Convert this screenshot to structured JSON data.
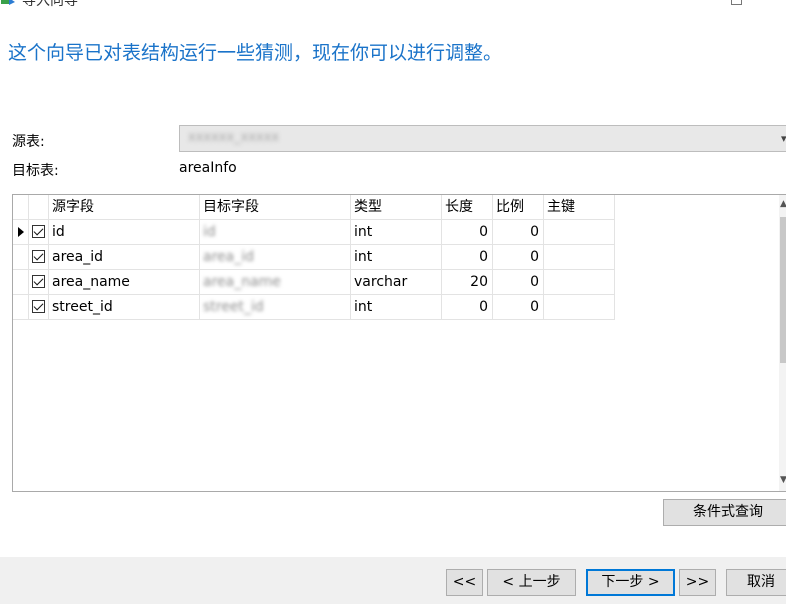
{
  "window": {
    "title": "导入向导"
  },
  "heading": "这个向导已对表结构运行一些猜测，现在你可以进行调整。",
  "source_table": {
    "label": "源表:",
    "value": "xxxxxx_xxxxx"
  },
  "target_table": {
    "label": "目标表:",
    "value": "areaInfo"
  },
  "grid": {
    "columns": [
      "源字段",
      "目标字段",
      "类型",
      "长度",
      "比例",
      "主键"
    ],
    "rows": [
      {
        "source": "id",
        "target": "id",
        "type": "int",
        "length": "0",
        "scale": "0",
        "pk": "",
        "checked": true,
        "current": true
      },
      {
        "source": "area_id",
        "target": "area_id",
        "type": "int",
        "length": "0",
        "scale": "0",
        "pk": "",
        "checked": true,
        "current": false
      },
      {
        "source": "area_name",
        "target": "area_name",
        "type": "varchar",
        "length": "20",
        "scale": "0",
        "pk": "",
        "checked": true,
        "current": false
      },
      {
        "source": "street_id",
        "target": "street_id",
        "type": "int",
        "length": "0",
        "scale": "0",
        "pk": "",
        "checked": true,
        "current": false
      }
    ]
  },
  "buttons": {
    "conditional_query": "条件式查询",
    "first": "<<",
    "prev": "< 上一步",
    "next": "下一步 >",
    "last": ">>",
    "cancel": "取消"
  }
}
